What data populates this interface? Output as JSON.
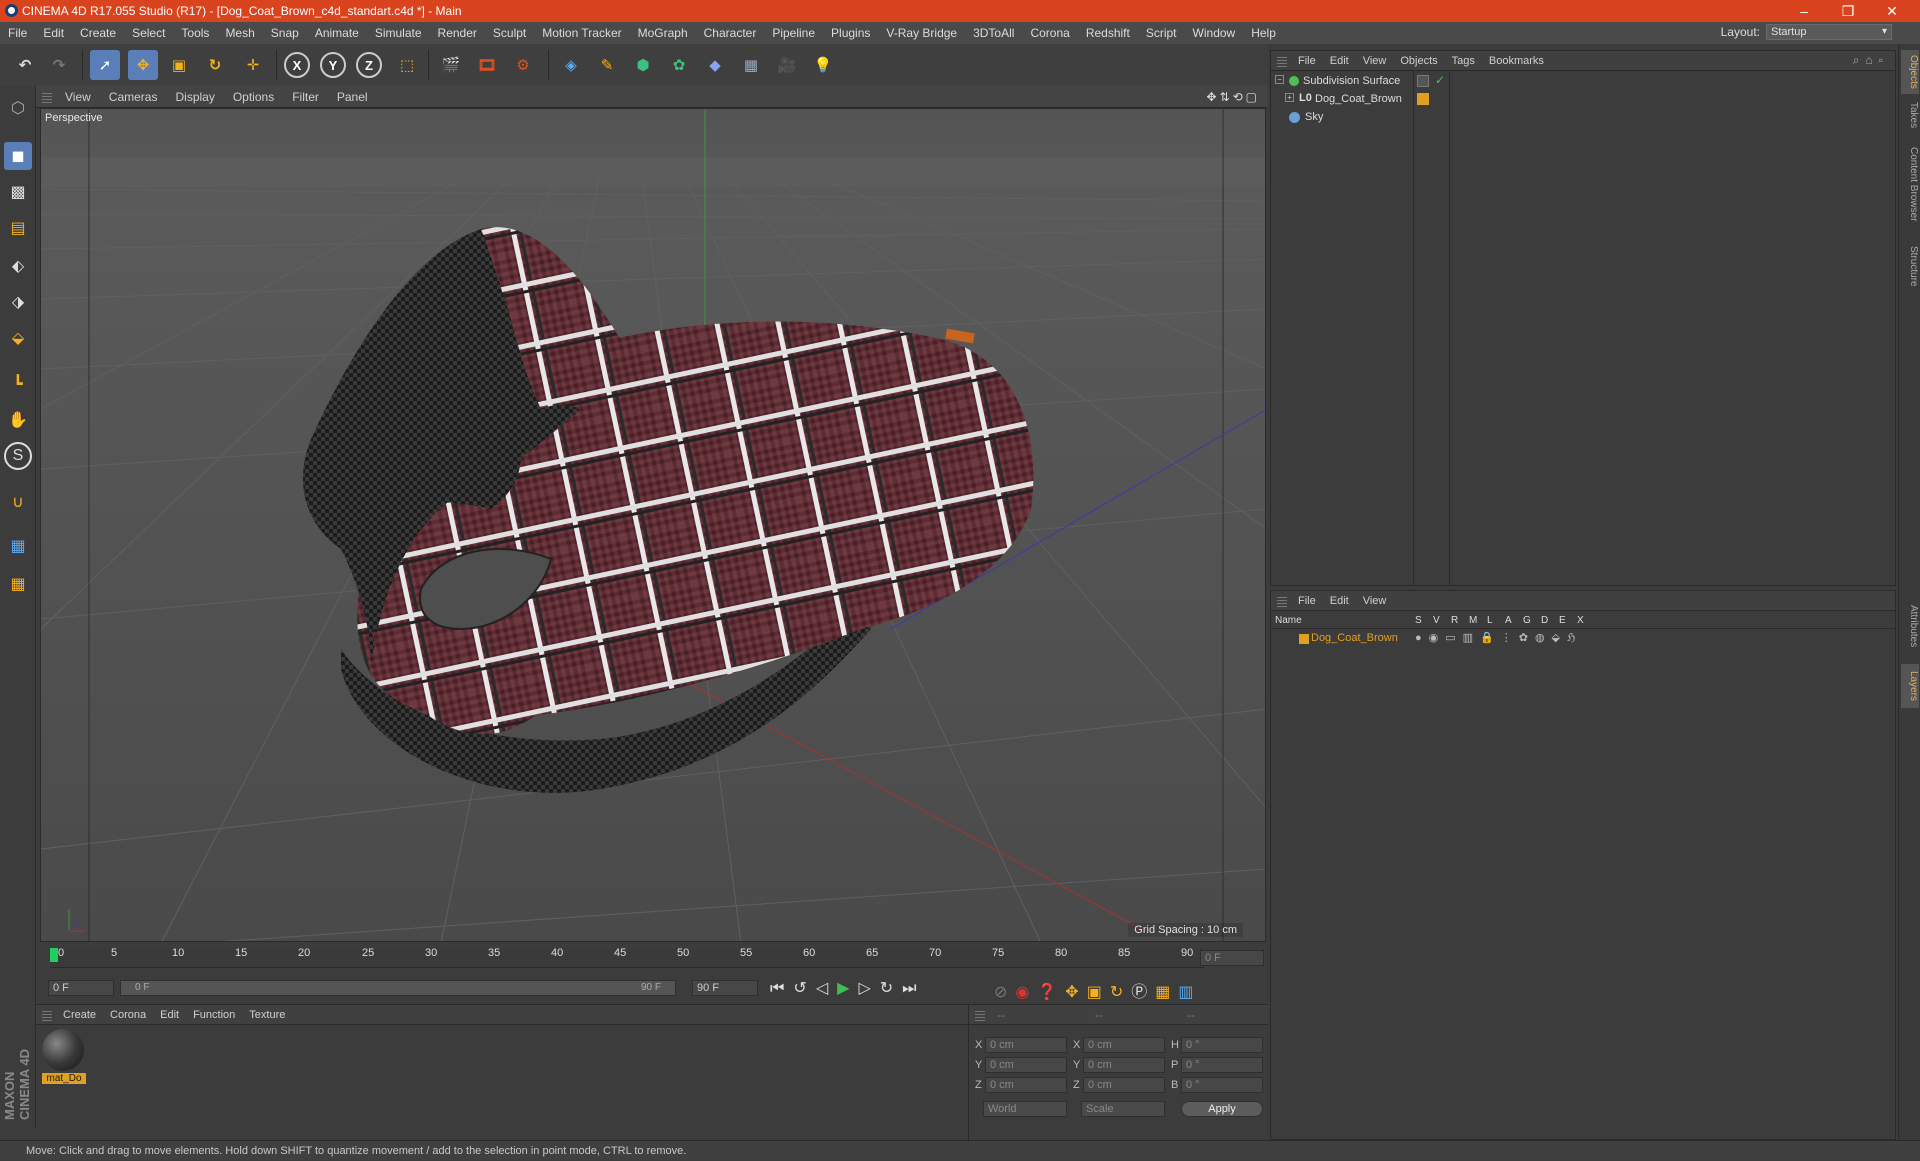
{
  "app": {
    "title": "CINEMA 4D R17.055 Studio (R17) - [Dog_Coat_Brown_c4d_standart.c4d *] - Main",
    "window_controls": {
      "minimize": "–",
      "restore": "❐",
      "close": "✕"
    }
  },
  "menubar": {
    "items": [
      "File",
      "Edit",
      "Create",
      "Select",
      "Tools",
      "Mesh",
      "Snap",
      "Animate",
      "Simulate",
      "Render",
      "Sculpt",
      "Motion Tracker",
      "MoGraph",
      "Character",
      "Pipeline",
      "Plugins",
      "V-Ray Bridge",
      "3DToAll",
      "Corona",
      "Redshift",
      "Script",
      "Window",
      "Help"
    ],
    "layout_label": "Layout:",
    "layout_value": "Startup"
  },
  "viewport": {
    "menu": [
      "View",
      "Cameras",
      "Display",
      "Options",
      "Filter",
      "Panel"
    ],
    "label": "Perspective",
    "grid_spacing": "Grid Spacing : 10 cm",
    "axis_x": "x",
    "axis_y": "y"
  },
  "timeline": {
    "ticks": [
      "0",
      "5",
      "10",
      "15",
      "20",
      "25",
      "30",
      "35",
      "40",
      "45",
      "50",
      "55",
      "60",
      "65",
      "70",
      "75",
      "80",
      "85",
      "90"
    ],
    "current_frame": "0 F",
    "start_field": "0 F",
    "range_start": "0 F",
    "range_end": "90 F",
    "end_field": "90 F"
  },
  "material_panel": {
    "menu": [
      "Create",
      "Corona",
      "Edit",
      "Function",
      "Texture"
    ],
    "material_name": "mat_Do"
  },
  "coords": {
    "header": [
      "--",
      "--",
      "--"
    ],
    "rows": [
      {
        "a": "X",
        "av": "0 cm",
        "b": "X",
        "bv": "0 cm",
        "c": "H",
        "cv": "0 °"
      },
      {
        "a": "Y",
        "av": "0 cm",
        "b": "Y",
        "bv": "0 cm",
        "c": "P",
        "cv": "0 °"
      },
      {
        "a": "Z",
        "av": "0 cm",
        "b": "Z",
        "bv": "0 cm",
        "c": "B",
        "cv": "0 °"
      }
    ],
    "world": "World",
    "scale": "Scale",
    "apply": "Apply"
  },
  "object_manager": {
    "menu": [
      "File",
      "Edit",
      "View",
      "Objects",
      "Tags",
      "Bookmarks"
    ],
    "items": [
      {
        "name": "Subdivision Surface",
        "color": "#4fc04f"
      },
      {
        "name": "Dog_Coat_Brown",
        "color": "#e0a020"
      },
      {
        "name": "Sky",
        "color": "#6a9fd8"
      }
    ]
  },
  "layer_manager": {
    "menu": [
      "File",
      "Edit",
      "View"
    ],
    "columns": [
      "Name",
      "S",
      "V",
      "R",
      "M",
      "L",
      "A",
      "G",
      "D",
      "E",
      "X"
    ],
    "layer_name": "Dog_Coat_Brown",
    "layer_color": "#e0a020"
  },
  "right_tabs": [
    "Objects",
    "Takes",
    "Content Browser",
    "Structure",
    "Attributes",
    "Layers"
  ],
  "status": "Move: Click and drag to move elements. Hold down SHIFT to quantize movement / add to the selection in point mode, CTRL to remove.",
  "brand": "MAXON CINEMA 4D"
}
